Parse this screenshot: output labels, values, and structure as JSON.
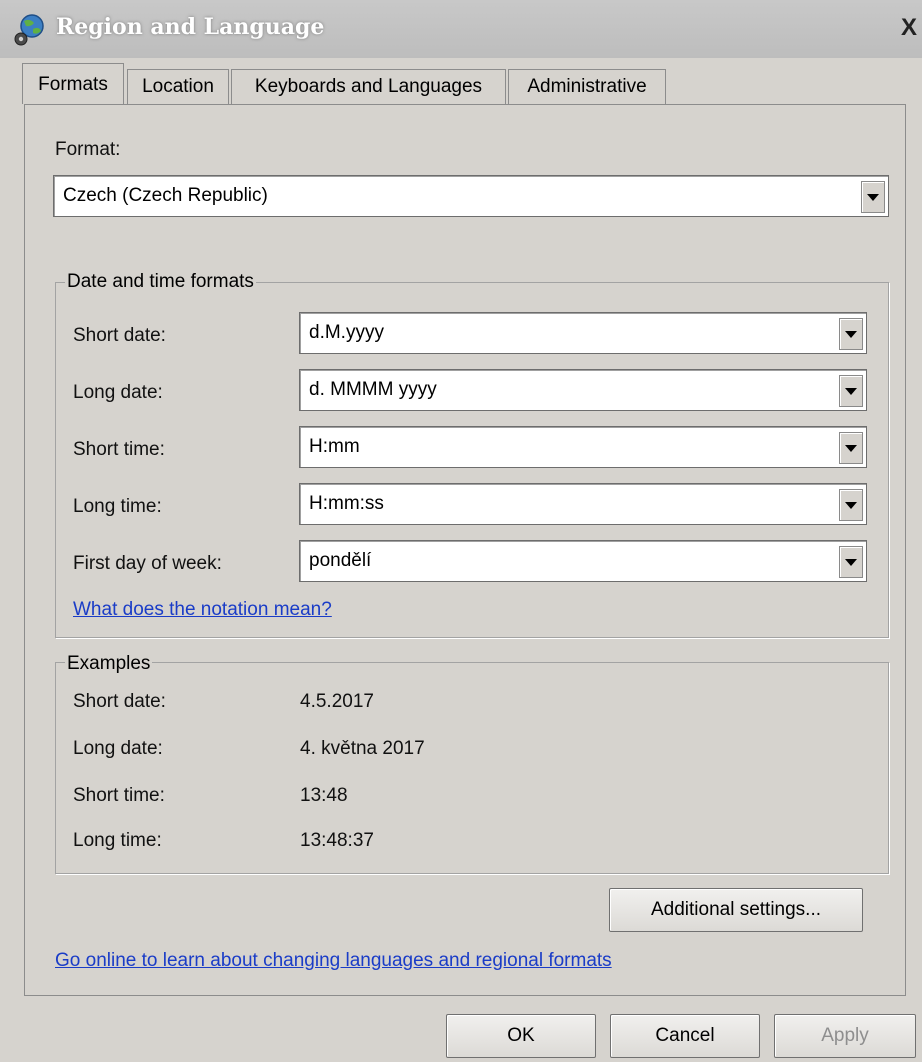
{
  "window": {
    "title": "Region and Language",
    "close_glyph": "X"
  },
  "tabs": [
    {
      "label": "Formats",
      "active": true
    },
    {
      "label": "Location",
      "active": false
    },
    {
      "label": "Keyboards and Languages",
      "active": false
    },
    {
      "label": "Administrative",
      "active": false
    }
  ],
  "format": {
    "label": "Format:",
    "value": "Czech (Czech Republic)"
  },
  "date_time_formats": {
    "title": "Date and time formats",
    "rows": [
      {
        "label": "Short date:",
        "value": "d.M.yyyy"
      },
      {
        "label": "Long date:",
        "value": "d. MMMM yyyy"
      },
      {
        "label": "Short time:",
        "value": "H:mm"
      },
      {
        "label": "Long time:",
        "value": "H:mm:ss"
      },
      {
        "label": "First day of week:",
        "value": "pondělí"
      }
    ],
    "notation_link": "What does the notation mean?"
  },
  "examples": {
    "title": "Examples",
    "rows": [
      {
        "label": "Short date:",
        "value": "4.5.2017"
      },
      {
        "label": "Long date:",
        "value": "4. května 2017"
      },
      {
        "label": "Short time:",
        "value": "13:48"
      },
      {
        "label": "Long time:",
        "value": "13:48:37"
      }
    ]
  },
  "additional_settings_button": "Additional settings...",
  "online_link": "Go online to learn about changing languages and regional formats",
  "footer": {
    "ok": "OK",
    "cancel": "Cancel",
    "apply": "Apply"
  },
  "icons": {
    "title_icon": "globe-icon",
    "dropdown_arrow": "chevron-down-icon"
  },
  "colors": {
    "link": "#1a3cc7",
    "window_bg": "#d6d3ce",
    "disabled_text": "#8e8e8e"
  }
}
